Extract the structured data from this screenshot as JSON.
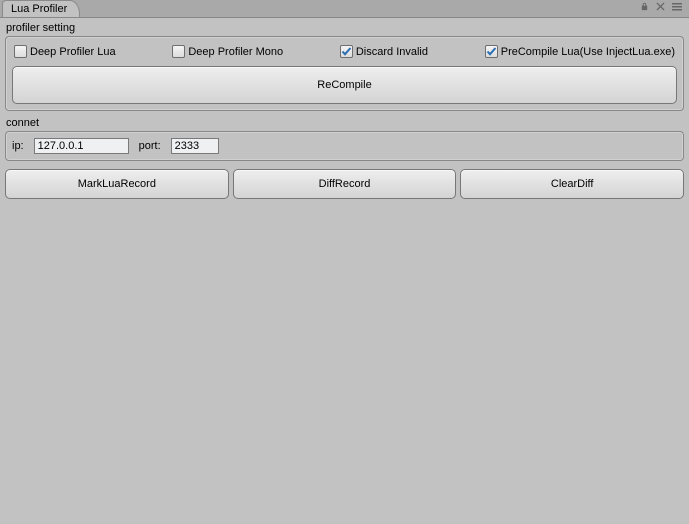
{
  "window": {
    "tab_title": "Lua Profiler"
  },
  "sections": {
    "profiler_label": "profiler setting",
    "connect_label": "connet"
  },
  "checks": {
    "deep_lua": {
      "label": "Deep Profiler Lua",
      "checked": false
    },
    "deep_mono": {
      "label": "Deep Profiler Mono",
      "checked": false
    },
    "discard_invalid": {
      "label": "Discard Invalid",
      "checked": true
    },
    "precompile": {
      "label": "PreCompile Lua(Use InjectLua.exe)",
      "checked": true
    }
  },
  "buttons": {
    "recompile": "ReCompile",
    "mark": "MarkLuaRecord",
    "diff": "DiffRecord",
    "clear": "ClearDiff"
  },
  "conn": {
    "ip_label": "ip:",
    "ip_value": "127.0.0.1",
    "port_label": "port:",
    "port_value": "2333"
  }
}
